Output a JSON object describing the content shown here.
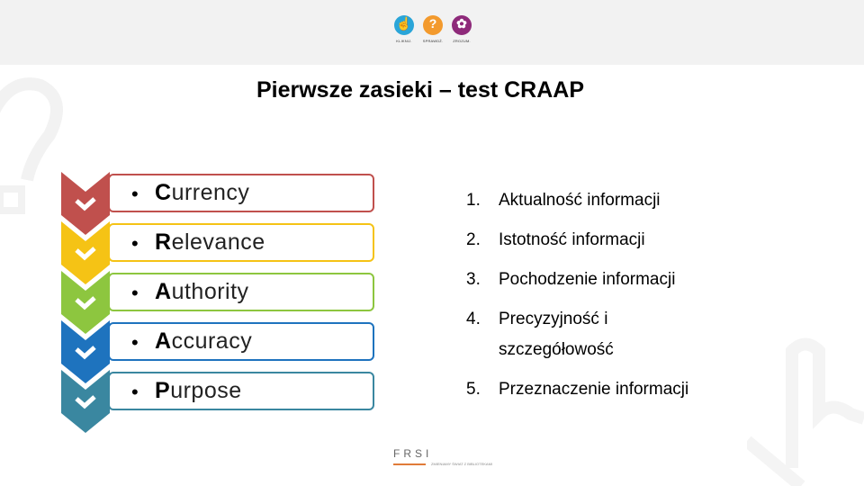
{
  "header": {
    "logos": [
      {
        "icon": "pointing-hand-icon",
        "label": "KLIKNIJ.",
        "color": "#2aa5d8"
      },
      {
        "icon": "question-mark-icon",
        "label": "SPRAWDŹ.",
        "color": "#f39a2d"
      },
      {
        "icon": "brain-icon",
        "label": "ZROZUM.",
        "color": "#8e2a7a"
      }
    ]
  },
  "title": "Pierwsze zasieki – test CRAAP",
  "craap": [
    {
      "initial": "C",
      "rest": "urrency",
      "color": "#c0504d"
    },
    {
      "initial": "R",
      "rest": "elevance",
      "color": "#f5c315"
    },
    {
      "initial": "A",
      "rest": "uthority",
      "color": "#8dc63f"
    },
    {
      "initial": "A",
      "rest": "ccuracy",
      "color": "#1e73be"
    },
    {
      "initial": "P",
      "rest": "urpose",
      "color": "#3a87a0"
    }
  ],
  "bullet": "•",
  "list": [
    {
      "num": "1.",
      "text": "Aktualność informacji"
    },
    {
      "num": "2.",
      "text": "Istotność informacji"
    },
    {
      "num": "3.",
      "text": "Pochodzenie informacji"
    },
    {
      "num": "4.",
      "text": "Precyzyjność i szczegółowość"
    },
    {
      "num": "5.",
      "text": "Przeznaczenie informacji"
    }
  ],
  "footer": {
    "brand": "FRSI",
    "tagline": "ZMIENIAMY ŚWIAT Z BIBLIOTEKAMI",
    "accent": "#e07b39"
  }
}
